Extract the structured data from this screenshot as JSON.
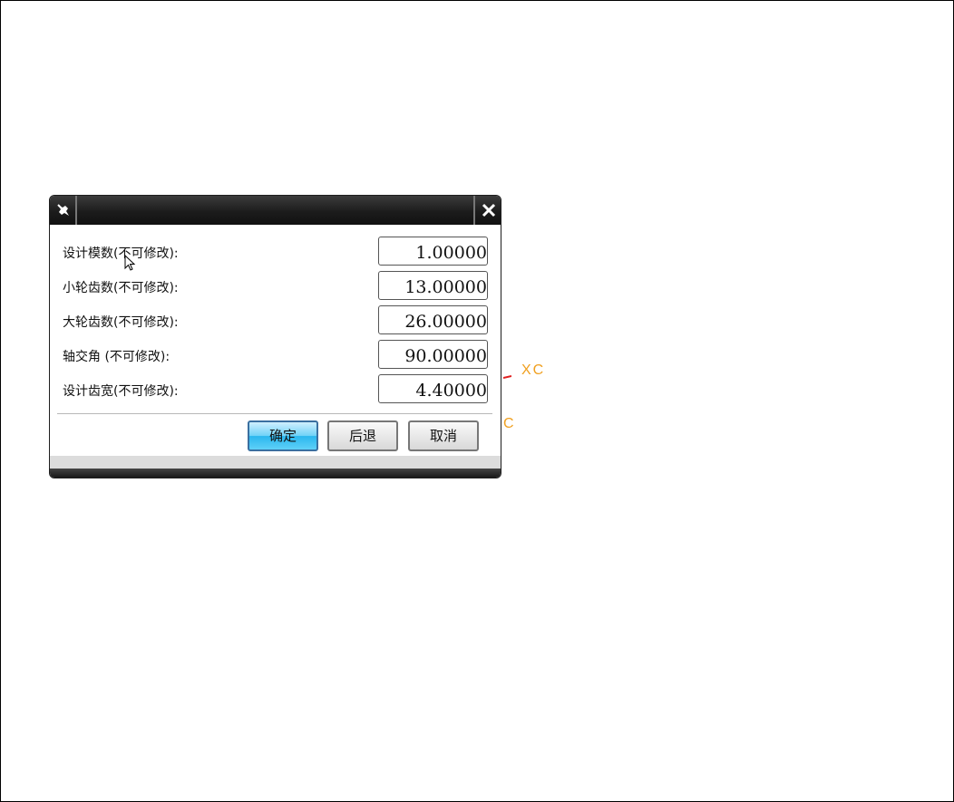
{
  "dialog": {
    "title": "",
    "rows": [
      {
        "label": "设计模数(不可修改):",
        "value": "1.00000"
      },
      {
        "label": "小轮齿数(不可修改):",
        "value": "13.00000"
      },
      {
        "label": "大轮齿数(不可修改):",
        "value": "26.00000"
      },
      {
        "label": "轴交角 (不可修改):",
        "value": "90.00000"
      },
      {
        "label": "设计齿宽(不可修改):",
        "value": "4.40000"
      }
    ],
    "buttons": {
      "ok": "确定",
      "back": "后退",
      "cancel": "取消"
    }
  },
  "canvas": {
    "axis_labels": {
      "xc": "XC",
      "c": "C"
    },
    "colors": {
      "axis_label": "#f0a020",
      "axis_tick": "#e02020",
      "primary_button": "#2ab7ee"
    }
  },
  "icons": {
    "pin": "pin-icon",
    "close": "close-icon",
    "cursor": "mouse-pointer-icon"
  }
}
